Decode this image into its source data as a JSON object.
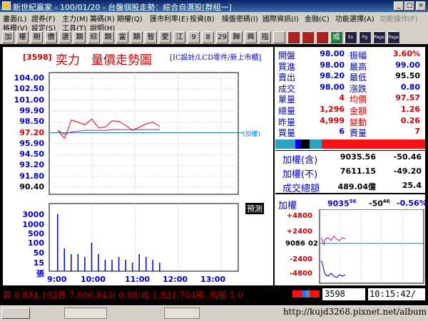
{
  "window": {
    "title": "新世紀贏家 - 100/01/20 - 台盤個股走勢：綜合自選股[群組一]"
  },
  "menubar": {
    "items": [
      "畫面(L)",
      "證券(F)",
      "主力(M)",
      "籌碼(R)",
      "期權(Q)",
      "匯市利率(E)",
      "投資(B)",
      "操盤密碼(I)",
      "國際資訊(I)",
      "金融(C)",
      "功能選擇(A)",
      "功能操作(F)",
      "格模(V)",
      "設定(S)",
      "工具(T)",
      "說明(H)"
    ],
    "disabled": [
      "功能操作(F)"
    ]
  },
  "toolbar": {
    "buttons": [
      "加",
      "權",
      "期",
      "價",
      "選",
      "類",
      "綜",
      "類",
      "當",
      "類",
      "智",
      "愛",
      "江",
      "9",
      "8",
      "29",
      "歸",
      "興",
      "指",
      "",
      "",
      "",
      "",
      "成",
      "Ex",
      "Pg",
      "Page",
      "Page"
    ]
  },
  "stock": {
    "code": "[3598]",
    "name": "奕力",
    "chart_title": "量價走勢圖",
    "tag": "[IC設計/LCD零件/新上市櫃]",
    "weight_label": "(加權)",
    "predict_label": "預測"
  },
  "price_axis": {
    "labels": [
      "104.00",
      "102.50",
      "101.00",
      "99.90",
      "98.50",
      "97.20",
      "95.90",
      "94.50",
      "93.20",
      "91.80",
      "90.40"
    ],
    "highlight": "97.20",
    "unhighlight": "90.40"
  },
  "volume_axis": {
    "labels": [
      "3000",
      "1000",
      "500",
      "100",
      "50",
      "15",
      "張"
    ]
  },
  "time_axis": {
    "labels": [
      "9:00",
      "10:00",
      "11:00",
      "12:00",
      "13:00"
    ]
  },
  "quote": {
    "rows": [
      {
        "l1": "開盤",
        "v1": "98.00",
        "l2": "振幅",
        "v2": "3.60%"
      },
      {
        "l1": "買進",
        "v1": "98.00",
        "l2": "最高",
        "v2": "99.00"
      },
      {
        "l1": "賣出",
        "v1": "98.20",
        "l2": "最低",
        "v2": "95.50"
      },
      {
        "l1": "成交",
        "v1": "98.00",
        "l2": "漲跌",
        "v2": "0.80"
      },
      {
        "l1": "單量",
        "v1": "4",
        "l2": "均價",
        "v2": "97.57"
      },
      {
        "l1": "總量",
        "v1": "1,296",
        "l2": "金額",
        "v2": "1.26"
      },
      {
        "l1": "昨量",
        "v1": "4,999",
        "l2": "變動",
        "v2": "0.26"
      },
      {
        "l1": "買量",
        "v1": "6",
        "l2": "賣量",
        "v2": "7"
      }
    ]
  },
  "index": {
    "rows": [
      {
        "l": "加權(含)",
        "v": "9035.56",
        "c": "-50.46"
      },
      {
        "l": "加權(不)",
        "v": "7611.15",
        "c": "-49.20"
      },
      {
        "l": "成交總額",
        "v": "489.04億",
        "c": "25.4"
      }
    ],
    "mini": {
      "label": "加權",
      "value": "9035",
      "value_sup": "56",
      "chg": "-50",
      "chg_sup": "46",
      "pct": "-0.56%",
      "axis": [
        "+4800",
        "+2400",
        "9086",
        "02",
        "-2400",
        "-4800"
      ]
    }
  },
  "status": {
    "text": "買 8,834,102賣 7,806,843( 0.88)成 1,921,704張, 均張 5.0",
    "code": "3598",
    "time": "10:15:42/"
  },
  "watermark": "http://kujd3268.pixnet.net/album",
  "chart_data": {
    "type": "line",
    "x": [
      "9:00",
      "9:05",
      "9:10",
      "9:15",
      "9:20",
      "9:25",
      "9:30",
      "9:35",
      "9:40",
      "9:45",
      "9:50",
      "9:55",
      "10:00",
      "10:05",
      "10:10",
      "10:15"
    ],
    "series": [
      {
        "values": [
          97.5,
          96.5,
          98.8,
          98.5,
          98.2,
          98.9,
          97.8,
          97.9,
          98.7,
          98.6,
          98.1,
          97.5,
          97.9,
          98.3,
          98.5,
          98.0
        ]
      },
      {
        "values": [
          97.5,
          97.0,
          97.3,
          97.4,
          97.5,
          97.5,
          97.5,
          97.5,
          97.6,
          97.6,
          97.6,
          97.6,
          97.6,
          97.6,
          97.6,
          97.6
        ]
      }
    ],
    "volume": [
      20,
      8,
      6,
      6,
      5,
      10,
      6,
      4,
      4,
      5,
      4,
      3,
      6,
      5,
      4,
      3
    ],
    "ylim": [
      90.4,
      104.0
    ],
    "reference": 97.2
  }
}
